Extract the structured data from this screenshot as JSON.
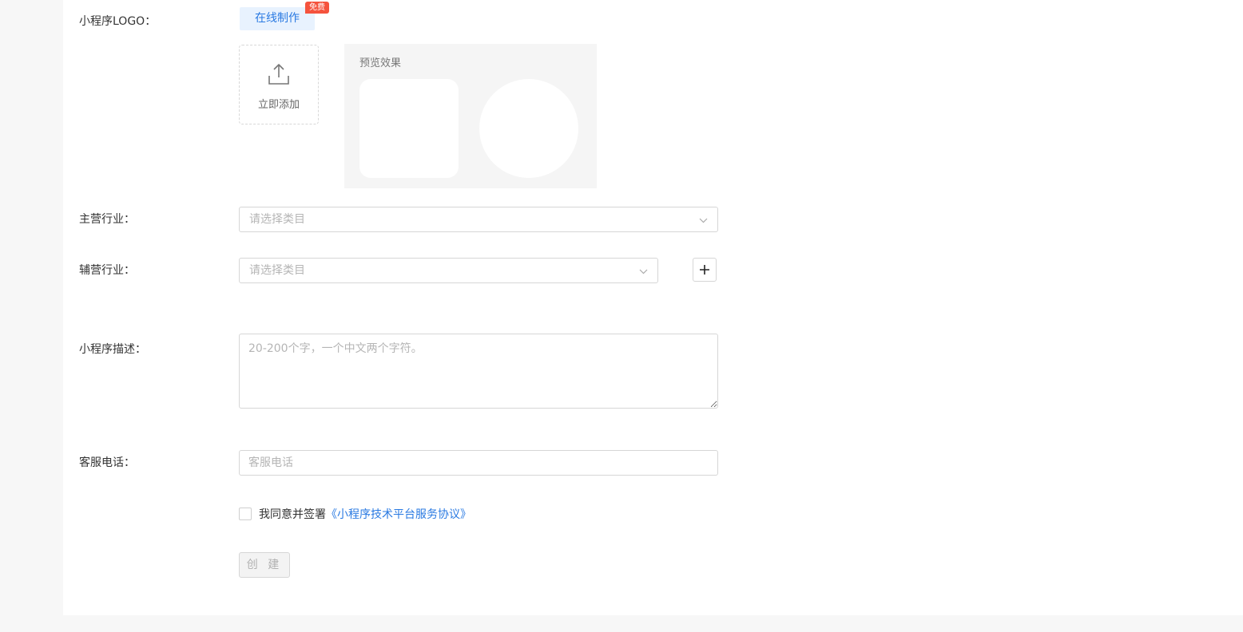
{
  "form": {
    "logo": {
      "label": "小程序LOGO：",
      "make_button": "在线制作",
      "free_badge": "免费",
      "upload_text": "立即添加",
      "preview_title": "预览效果"
    },
    "main_industry": {
      "label": "主营行业：",
      "placeholder": "请选择类目"
    },
    "sub_industry": {
      "label": "辅营行业：",
      "placeholder": "请选择类目"
    },
    "description": {
      "label": "小程序描述：",
      "placeholder": "20-200个字，一个中文两个字符。"
    },
    "phone": {
      "label": "客服电话：",
      "placeholder": "客服电话"
    },
    "agreement": {
      "text": "我同意并签署",
      "link": "《小程序技术平台服务协议》"
    },
    "submit_label": "创 建"
  },
  "icons": {
    "upload": "upload-icon",
    "chevron": "chevron-down-icon",
    "plus": "plus-icon"
  }
}
